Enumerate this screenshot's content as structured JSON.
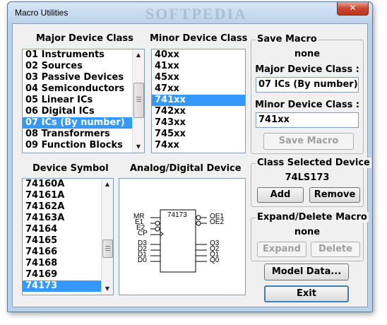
{
  "window": {
    "title": "Macro Utilities",
    "watermark": "SOFTPEDIA",
    "close_glyph": "✕"
  },
  "major": {
    "label": "Major Device Class",
    "items": [
      "01 Instruments",
      "02 Sources",
      "03 Passive Devices",
      "04 Semiconductors",
      "05 Linear ICs",
      "06 Digital ICs",
      "07 ICs (By number)",
      "08 Transformers",
      "09 Function Blocks"
    ],
    "selected": "07 ICs (By number)"
  },
  "minor": {
    "label": "Minor Device Class",
    "items": [
      "40xx",
      "41xx",
      "45xx",
      "47xx",
      "741xx",
      "742xx",
      "743xx",
      "745xx",
      "74xx"
    ],
    "selected": "741xx"
  },
  "symbol": {
    "label": "Device Symbol",
    "items": [
      "74160A",
      "74161A",
      "74162A",
      "74163A",
      "74164",
      "74165",
      "74166",
      "74168",
      "74169",
      "74173"
    ],
    "selected": "74173"
  },
  "analog_digital": {
    "label": "Analog/Digital Device",
    "chip_name": "74173",
    "left_pins": [
      "MR",
      "E1",
      "E2",
      "CP",
      "D3",
      "D2",
      "D1",
      "D0"
    ],
    "right_pins": [
      "OE1",
      "OE2",
      "Q3",
      "Q2",
      "Q1",
      "Q0"
    ]
  },
  "save_macro": {
    "title": "Save Macro",
    "status": "none",
    "major_label": "Major Device Class :",
    "major_value": "07 ICs (By number)",
    "minor_label": "Minor Device Class :",
    "minor_value": "741xx",
    "button": "Save Macro"
  },
  "class_selected": {
    "title": "Class Selected Device",
    "device": "74LS173",
    "add": "Add",
    "remove": "Remove"
  },
  "expand_delete": {
    "title": "Expand/Delete Macro",
    "status": "none",
    "expand": "Expand",
    "delete": "Delete"
  },
  "model_data_button": "Model Data...",
  "exit_button": "Exit"
}
